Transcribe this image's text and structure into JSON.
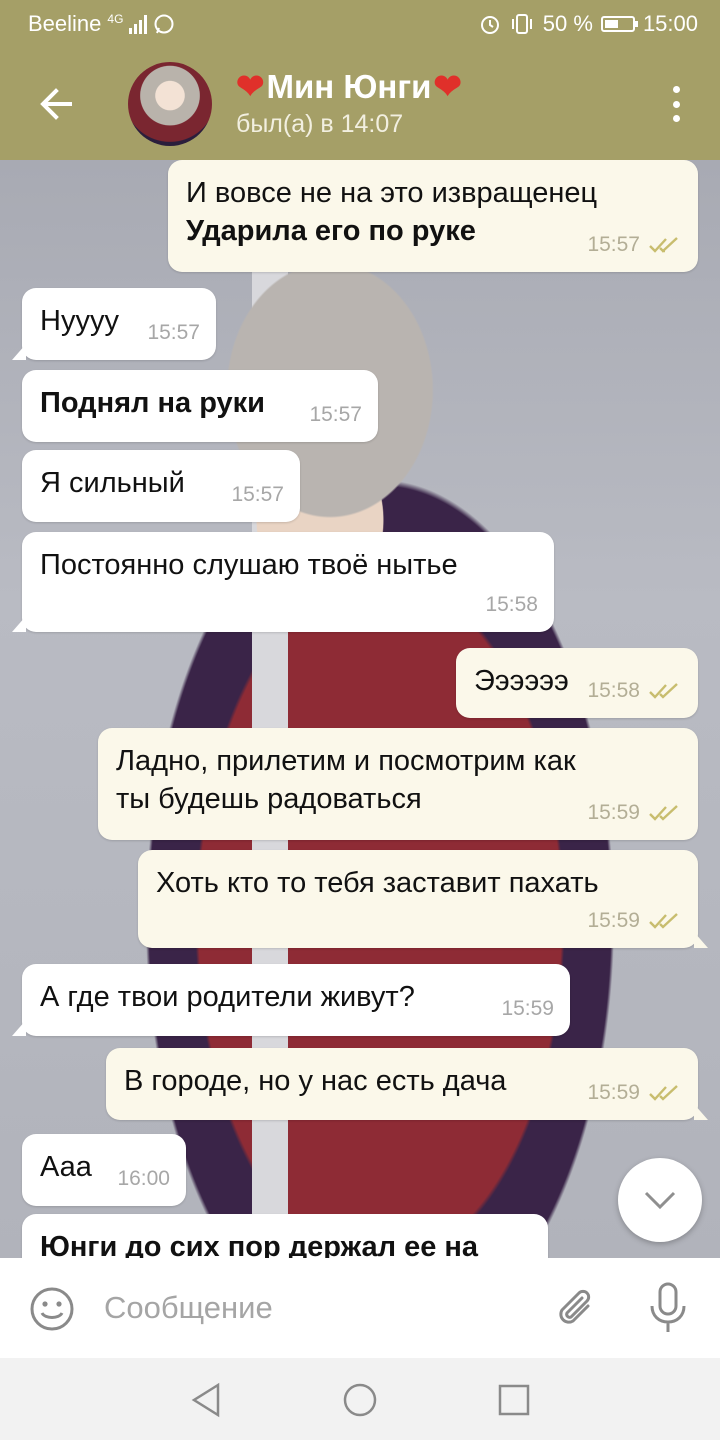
{
  "status_bar": {
    "carrier": "Beeline",
    "network": "4G",
    "battery": "50 %",
    "battery_level": 0.5,
    "time": "15:00"
  },
  "header": {
    "name": "Мин Юнги",
    "status": "был(а) в 14:07",
    "heart_glyph": "❤"
  },
  "messages": [
    {
      "dir": "out",
      "lines": [
        "И вовсе не на это извращенец"
      ],
      "bold": [
        "Ударила его по руке"
      ],
      "time": "15:57",
      "read": true
    },
    {
      "dir": "in",
      "text": "Нуууу",
      "time": "15:57"
    },
    {
      "dir": "in",
      "text": "Поднял на руки",
      "bold": true,
      "time": "15:57"
    },
    {
      "dir": "in",
      "text": "Я сильный",
      "time": "15:57"
    },
    {
      "dir": "in",
      "text": "Постоянно слушаю твоё нытье",
      "time": "15:58"
    },
    {
      "dir": "out",
      "text": "Ээээээ",
      "time": "15:58",
      "read": true
    },
    {
      "dir": "out",
      "text": "Ладно, прилетим и посмотрим как\nты будешь радоваться",
      "time": "15:59",
      "read": true
    },
    {
      "dir": "out",
      "text": "Хоть кто то тебя заставит пахать",
      "time": "15:59",
      "read": true
    },
    {
      "dir": "in",
      "text": "А где твои родители живут?",
      "time": "15:59"
    },
    {
      "dir": "out",
      "text": "В городе, но у нас есть дача",
      "time": "15:59",
      "read": true
    },
    {
      "dir": "in",
      "text": "Ааа",
      "time": "16:00"
    },
    {
      "dir": "in",
      "text": "Юнги до сих пор держал ее на",
      "bold": true,
      "time": ""
    }
  ],
  "input": {
    "placeholder": "Сообщение"
  },
  "icons": {
    "back": "back-arrow-icon",
    "menu": "more-vertical-icon",
    "emoji": "smile-icon",
    "attach": "paperclip-icon",
    "mic": "microphone-icon",
    "scroll": "chevron-down-icon"
  },
  "colors": {
    "header": "#a59f67",
    "outgoing_bubble": "#fbf8ea",
    "incoming_bubble": "#ffffff",
    "read_ticks": "#c8bd6e",
    "heart": "#e0302a"
  }
}
